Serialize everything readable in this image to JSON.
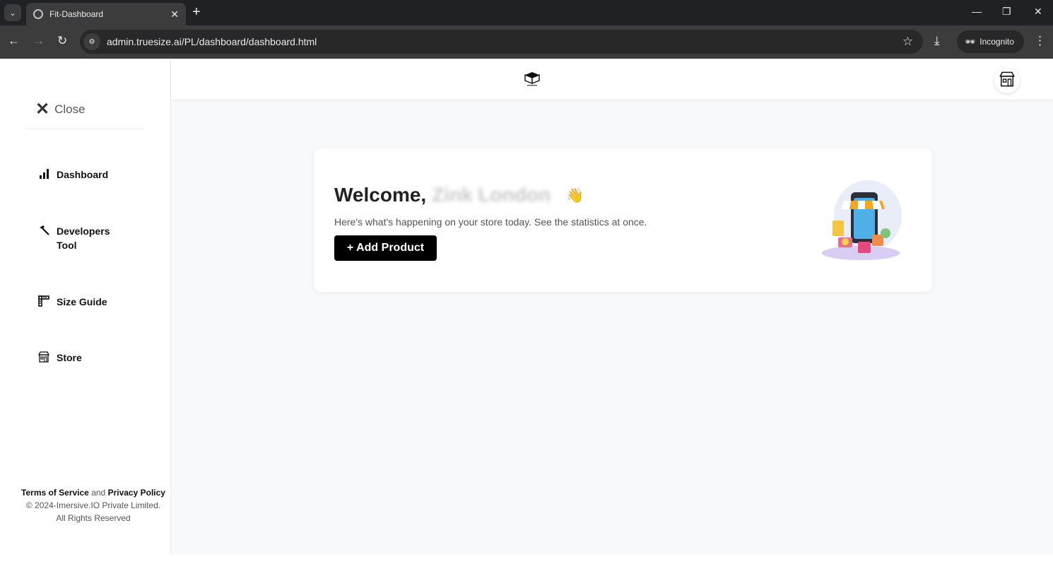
{
  "browser": {
    "tab_title": "Fit-Dashboard",
    "url": "admin.truesize.ai/PL/dashboard/dashboard.html",
    "incognito_label": "Incognito"
  },
  "sidebar": {
    "close_label": "Close",
    "items": [
      {
        "label": "Dashboard",
        "icon": "bar-chart-icon"
      },
      {
        "label": "Developers Tool",
        "icon": "hammer-icon"
      },
      {
        "label": "Size Guide",
        "icon": "ruler-icon"
      },
      {
        "label": "Store",
        "icon": "store-icon"
      }
    ],
    "footer": {
      "terms": "Terms of Service",
      "and": "and",
      "privacy": "Privacy Policy",
      "copyright": "© 2024-Imersive.IO Private Limited.",
      "rights": "All Rights Reserved"
    }
  },
  "main": {
    "welcome_prefix": "Welcome,",
    "user_name": "Zink London",
    "wave": "👋",
    "subtitle": "Here's what's happening on your store today. See the statistics at once.",
    "add_product_label": "+ Add Product"
  },
  "colors": {
    "accent": "#000000",
    "page_bg": "#f8f9fb",
    "chrome_dark": "#202124"
  }
}
